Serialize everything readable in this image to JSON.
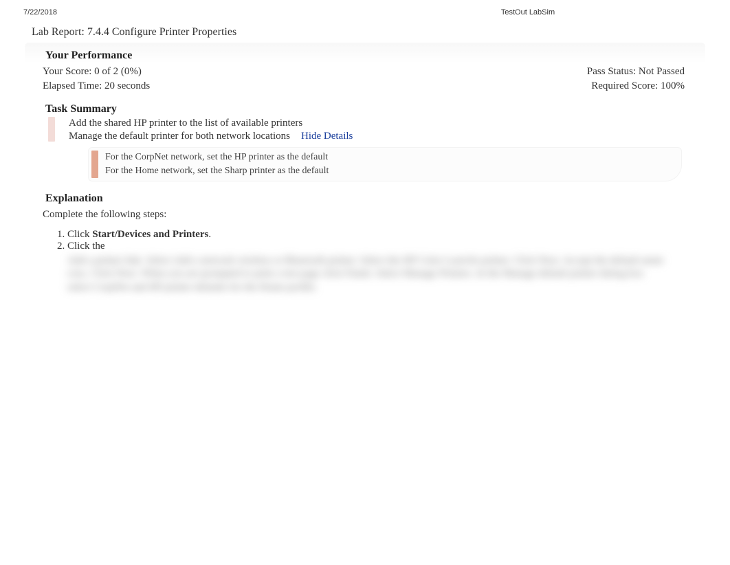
{
  "header": {
    "date": "7/22/2018",
    "product": "TestOut LabSim"
  },
  "lab_title": "Lab Report: 7.4.4 Configure Printer Properties",
  "performance": {
    "heading": "Your Performance",
    "score_label": "Your Score: 0 of 2 (0%)",
    "pass_status": "Pass Status: Not Passed",
    "elapsed": "Elapsed Time: 20 seconds",
    "required": "Required Score: 100%"
  },
  "task_summary": {
    "heading": "Task Summary",
    "task1": "Add the shared HP printer to the list of available printers",
    "task2": "Manage the default printer for both network locations",
    "hide_details": "Hide Details",
    "detail1": "For the CorpNet network, set the HP printer as the default",
    "detail2": "For the Home network, set the Sharp printer as the default"
  },
  "explanation": {
    "heading": "Explanation",
    "intro": "Complete the following steps:",
    "step1_prefix": "Click ",
    "step1_bold": "Start/Devices and Printers",
    "step1_suffix": ".",
    "step2": "Click the"
  },
  "blurred_placeholder": "Add a printer link. Select Add a network wireless or Bluetooth printer. Select the HP Color LaserJet printer. Click Next. Accept the default name crux. Click Next. When you are prompted to print a test page click Finish. Select Manage Printers. In the Manage default printer dialog box select CorpNet and HP printer defaults for the Home profile."
}
